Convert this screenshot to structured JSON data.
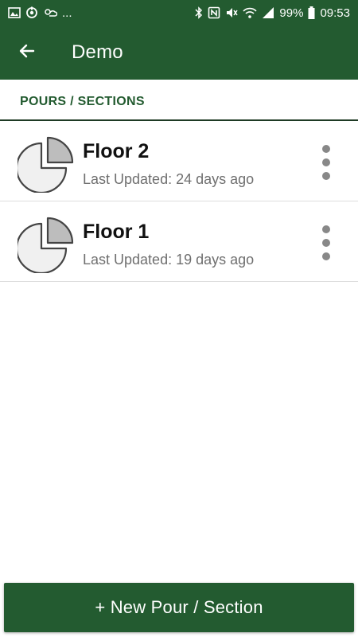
{
  "status_bar": {
    "left_icons": [
      "image-icon",
      "sync-icon",
      "weather-icon"
    ],
    "left_more": "...",
    "right_icons": [
      "bluetooth-icon",
      "nfc-icon",
      "mute-icon",
      "wifi-icon",
      "signal-icon"
    ],
    "battery_text": "99%",
    "time": "09:53"
  },
  "app_bar": {
    "back_icon": "arrow-left-icon",
    "title": "Demo"
  },
  "section": {
    "title": "POURS / SECTIONS"
  },
  "items": [
    {
      "title": "Floor 2",
      "subtitle": "Last Updated: 24 days ago",
      "icon": "pie-chart-icon",
      "menu_icon": "more-vertical-icon"
    },
    {
      "title": "Floor 1",
      "subtitle": "Last Updated: 19 days ago",
      "icon": "pie-chart-icon",
      "menu_icon": "more-vertical-icon"
    }
  ],
  "new_button": {
    "label": "+ New Pour / Section"
  },
  "colors": {
    "primary": "#235b30",
    "text": "#111111",
    "subtext": "#6f6f6f",
    "divider": "#dddddd"
  }
}
